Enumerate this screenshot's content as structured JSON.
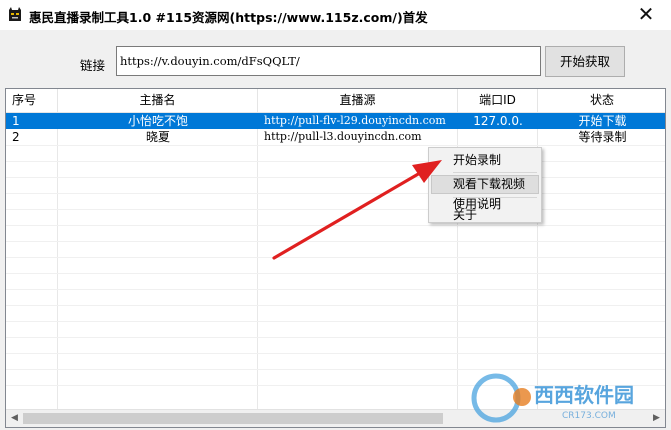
{
  "window": {
    "title": "惠民直播录制工具1.0 #115资源网(https://www.115z.com/)首发",
    "close_glyph": "✕"
  },
  "toolbar": {
    "link_label": "链接",
    "link_value": "https://v.douyin.com/dFsQQLT/",
    "start_button": "开始获取"
  },
  "table": {
    "columns": [
      "序号",
      "主播名",
      "直播源",
      "端口ID",
      "状态"
    ],
    "rows": [
      {
        "index": "1",
        "name": "小怡吃不饱",
        "source": "http://pull-flv-l29.douyincdn.com",
        "port": "127.0.0.",
        "status": "开始下载",
        "selected": true
      },
      {
        "index": "2",
        "name": "晓夏",
        "source": "http://pull-l3.douyincdn.com",
        "port": "",
        "status": "等待录制",
        "selected": false
      }
    ]
  },
  "context_menu": {
    "items": [
      "开始录制",
      "观看下载视频",
      "使用说明",
      "关于"
    ],
    "hovered": "观看下载视频"
  },
  "watermark": {
    "text_brand": "西西软件园",
    "text_url": "CR173.COM"
  },
  "colors": {
    "selection": "#0078d7",
    "arrow": "#e02020"
  }
}
